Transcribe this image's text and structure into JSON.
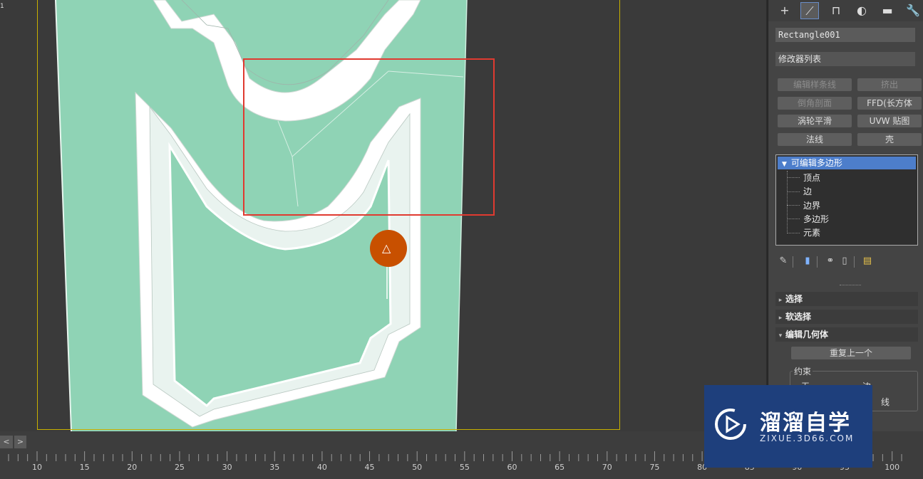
{
  "viewport": {
    "corner_mark": "1"
  },
  "panel": {
    "tabs": [
      {
        "name": "create-tab",
        "glyph": "+"
      },
      {
        "name": "modify-tab",
        "glyph": "⟋"
      },
      {
        "name": "hierarchy-tab",
        "glyph": "⊓"
      },
      {
        "name": "motion-tab",
        "glyph": "◐"
      },
      {
        "name": "display-tab",
        "glyph": "▬"
      },
      {
        "name": "utilities-tab",
        "glyph": "🔧"
      }
    ],
    "object_name": "Rectangle001",
    "modifier_list": "修改器列表",
    "buttons": [
      {
        "label": "编辑样条线",
        "dim": true
      },
      {
        "label": "挤出",
        "dim": true
      },
      {
        "label": "倒角剖面",
        "dim": true
      },
      {
        "label": "FFD(长方体",
        "dim": false
      },
      {
        "label": "涡轮平滑",
        "dim": false
      },
      {
        "label": "UVW 贴图",
        "dim": false
      },
      {
        "label": "法线",
        "dim": false
      },
      {
        "label": "壳",
        "dim": false
      }
    ],
    "stack": {
      "head": "可编辑多边形",
      "items": [
        "顶点",
        "边",
        "边界",
        "多边形",
        "元素"
      ]
    },
    "rollouts": [
      {
        "arrow": "▸",
        "label": "选择"
      },
      {
        "arrow": "▸",
        "label": "软选择"
      },
      {
        "arrow": "▾",
        "label": "编辑几何体"
      }
    ],
    "repeat_last": "重复上一个",
    "constraints": {
      "label": "约束",
      "opt1": "无",
      "opt2": "边",
      "opt3": "线"
    }
  },
  "timeline": {
    "prev": "<",
    "next": ">",
    "labels": [
      "10",
      "15",
      "20",
      "25",
      "30",
      "35",
      "40",
      "45",
      "50",
      "55",
      "60",
      "65",
      "70",
      "75",
      "80",
      "85",
      "90",
      "95",
      "100"
    ]
  },
  "watermark": {
    "title": "溜溜自学",
    "subtitle": "ZIXUE.3D66.COM"
  },
  "colors": {
    "mesh": "#8fd3b5",
    "selection": "#e03a30",
    "highlight": "#4d7ecb",
    "badge": "#c85000"
  }
}
